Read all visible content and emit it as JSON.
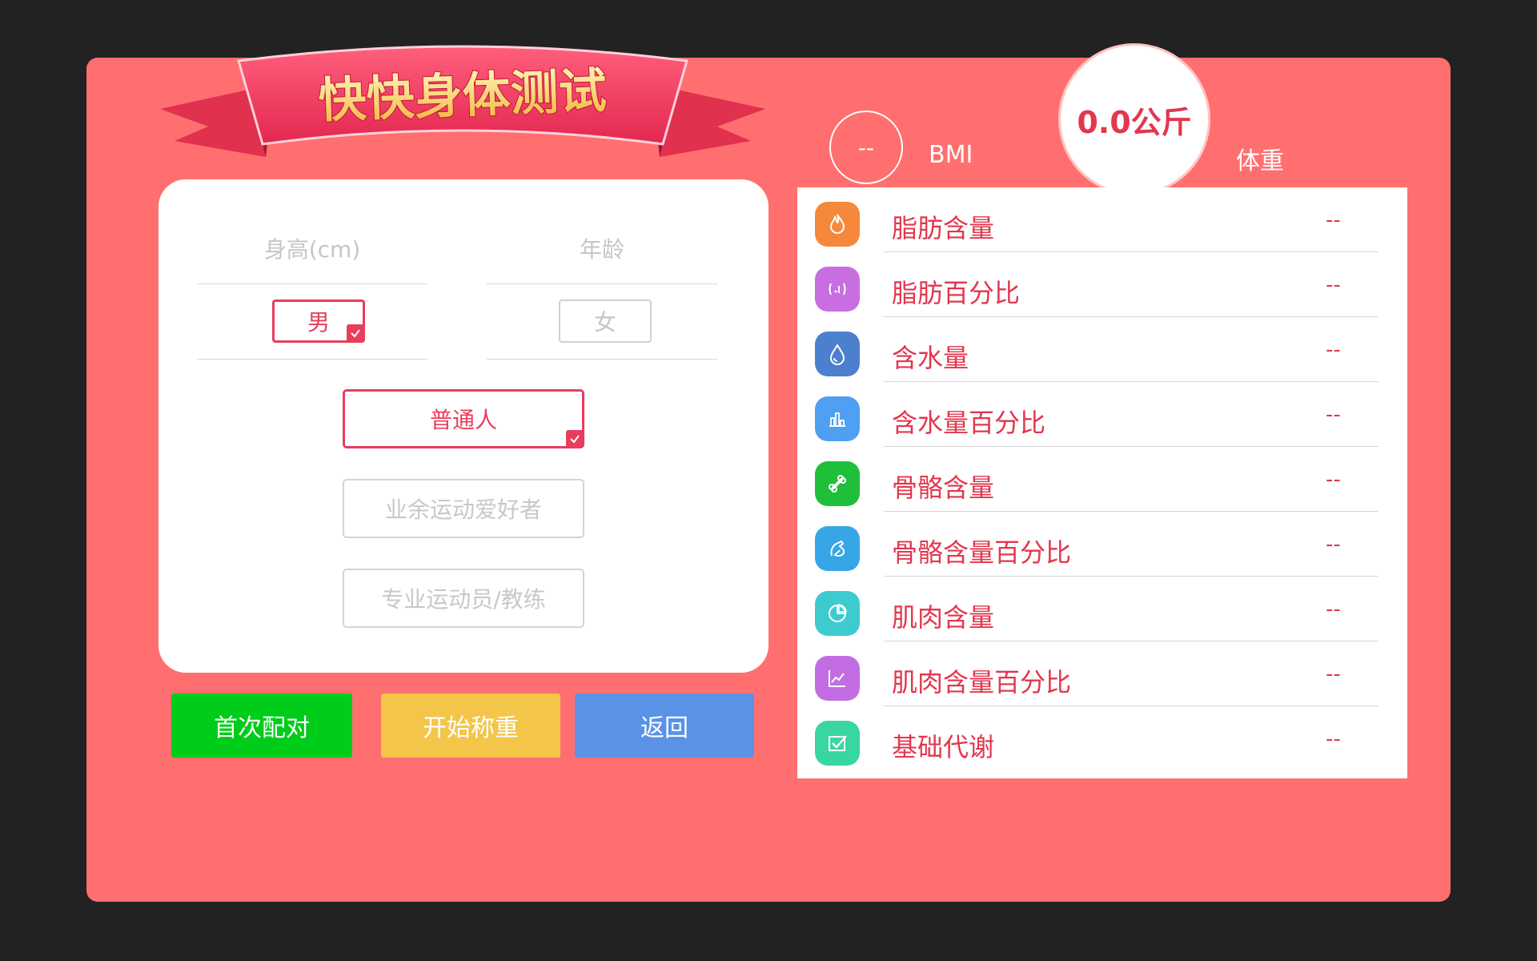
{
  "app": {
    "title": "快快身体测试"
  },
  "form": {
    "height_label": "身高(cm)",
    "age_label": "年龄",
    "gender": {
      "male": "男",
      "female": "女",
      "selected": "male"
    },
    "levels": [
      {
        "label": "普通人",
        "selected": true
      },
      {
        "label": "业余运动爱好者",
        "selected": false
      },
      {
        "label": "专业运动员/教练",
        "selected": false
      }
    ]
  },
  "actions": {
    "pair_label": "首次配对",
    "weigh_label": "开始称重",
    "back_label": "返回"
  },
  "summary": {
    "bmi_value": "--",
    "bmi_label": "BMI",
    "weight_value": "0.0公斤",
    "weight_label": "体重"
  },
  "metrics": [
    {
      "label": "脂肪含量",
      "value": "--",
      "icon": "flame-icon",
      "color": "#f5883a"
    },
    {
      "label": "脂肪百分比",
      "value": "--",
      "icon": "waist-icon",
      "color": "#c86ee0"
    },
    {
      "label": "含水量",
      "value": "--",
      "icon": "water-drop-icon",
      "color": "#4d7fcf"
    },
    {
      "label": "含水量百分比",
      "value": "--",
      "icon": "bar-chart-icon",
      "color": "#4f9ff2"
    },
    {
      "label": "骨骼含量",
      "value": "--",
      "icon": "bone-icon",
      "color": "#1fbf3a"
    },
    {
      "label": "骨骼含量百分比",
      "value": "--",
      "icon": "arm-muscle-icon",
      "color": "#37a6e6"
    },
    {
      "label": "肌肉含量",
      "value": "--",
      "icon": "pie-chart-icon",
      "color": "#3dcbd0"
    },
    {
      "label": "肌肉含量百分比",
      "value": "--",
      "icon": "line-chart-icon",
      "color": "#c26ee2"
    },
    {
      "label": "基础代谢",
      "value": "--",
      "icon": "checklist-icon",
      "color": "#3ad6a0"
    }
  ],
  "colors": {
    "panel": "#ff6f6f",
    "accent": "#e83d5b",
    "pair_button": "#00cc1a",
    "weigh_button": "#f3c64a",
    "back_button": "#5a93e6"
  }
}
